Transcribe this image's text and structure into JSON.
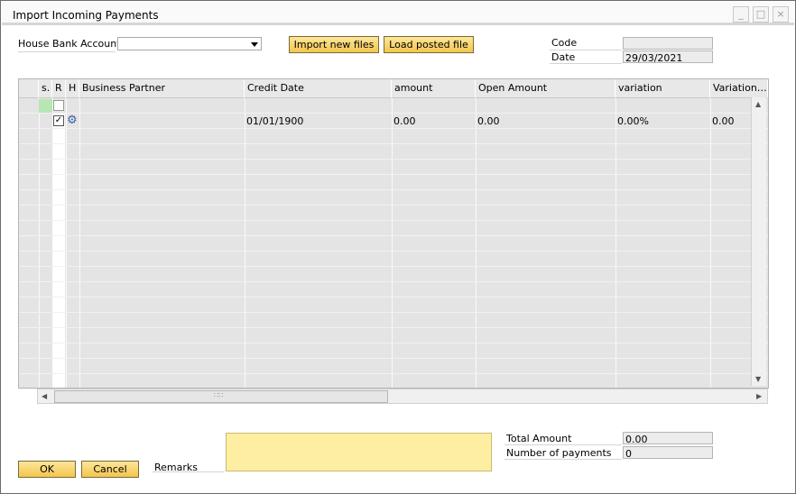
{
  "window": {
    "title": "Import Incoming Payments",
    "buttons": [
      "_",
      "□",
      "×"
    ]
  },
  "header": {
    "house_bank_label": "House Bank Account",
    "house_bank_value": "",
    "import_button": "Import new files",
    "load_button": "Load posted file",
    "code_label": "Code",
    "code_value": "",
    "date_label": "Date",
    "date_value": "29/03/2021"
  },
  "grid": {
    "columns": [
      "s.",
      "R",
      "H",
      "Business Partner",
      "Credit Date",
      "amount",
      "Open Amount",
      "variation",
      "Variation…"
    ],
    "row": {
      "r_checked": "✓",
      "credit_date": "01/01/1900",
      "amount": "0.00",
      "open_amount": "0.00",
      "variation": "0.00%",
      "variation2": "0.00"
    },
    "scroll_grip": "∷∷"
  },
  "footer": {
    "ok_button": "OK",
    "cancel_button": "Cancel",
    "remarks_label": "Remarks",
    "remarks_value": "",
    "total_amount_label": "Total Amount",
    "total_amount_value": "0.00",
    "num_payments_label": "Number of payments",
    "num_payments_value": "0"
  },
  "icons": {
    "row_settings": "gear-icon",
    "dropdown": "chevron-down-icon"
  }
}
